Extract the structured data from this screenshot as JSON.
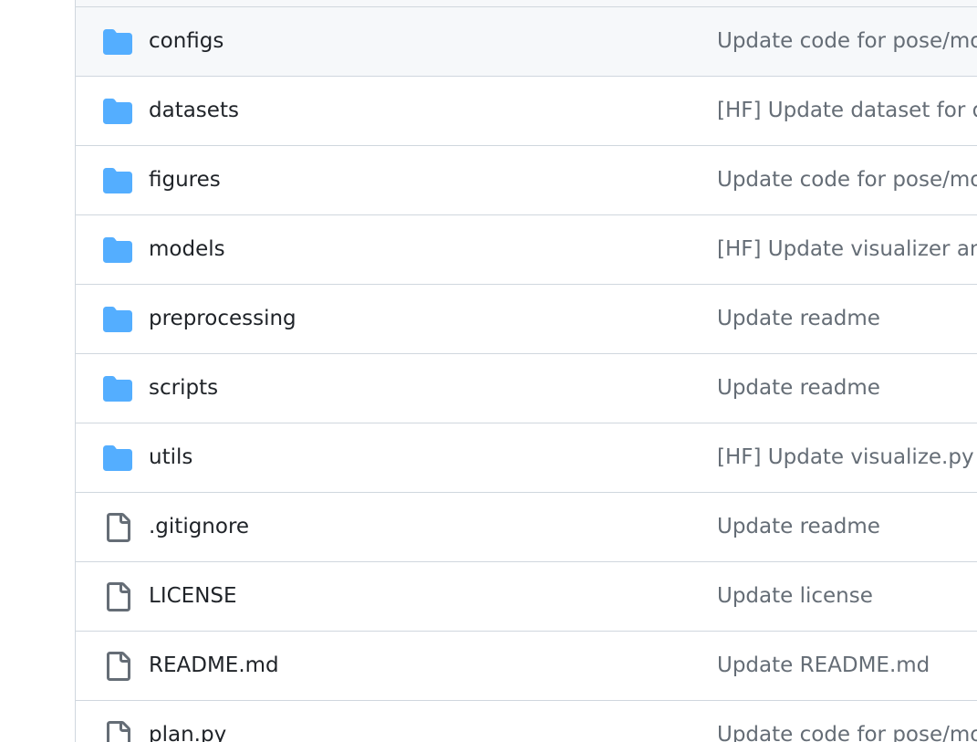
{
  "colors": {
    "folder_icon": "#54aeff",
    "file_icon": "#656d76",
    "name_text": "#1f2328",
    "commit_text": "#656d76",
    "border": "#d0d7de",
    "hover_bg": "#f6f8fa"
  },
  "files": [
    {
      "name": "configs",
      "type": "folder",
      "icon": "folder-icon",
      "commit": "Update code for pose/mo"
    },
    {
      "name": "datasets",
      "type": "folder",
      "icon": "folder-icon",
      "commit": "[HF] Update dataset for d"
    },
    {
      "name": "figures",
      "type": "folder",
      "icon": "folder-icon",
      "commit": "Update code for pose/mo"
    },
    {
      "name": "models",
      "type": "folder",
      "icon": "folder-icon",
      "commit": "[HF] Update visualizer an"
    },
    {
      "name": "preprocessing",
      "type": "folder",
      "icon": "folder-icon",
      "commit": "Update readme"
    },
    {
      "name": "scripts",
      "type": "folder",
      "icon": "folder-icon",
      "commit": "Update readme"
    },
    {
      "name": "utils",
      "type": "folder",
      "icon": "folder-icon",
      "commit": "[HF] Update visualize.py f"
    },
    {
      "name": ".gitignore",
      "type": "file",
      "icon": "file-icon",
      "commit": "Update readme"
    },
    {
      "name": "LICENSE",
      "type": "file",
      "icon": "file-icon",
      "commit": "Update license"
    },
    {
      "name": "README.md",
      "type": "file",
      "icon": "file-icon",
      "commit": "Update README.md"
    },
    {
      "name": "plan.py",
      "type": "file",
      "icon": "file-icon",
      "commit": "Update code for pose/mo"
    }
  ]
}
